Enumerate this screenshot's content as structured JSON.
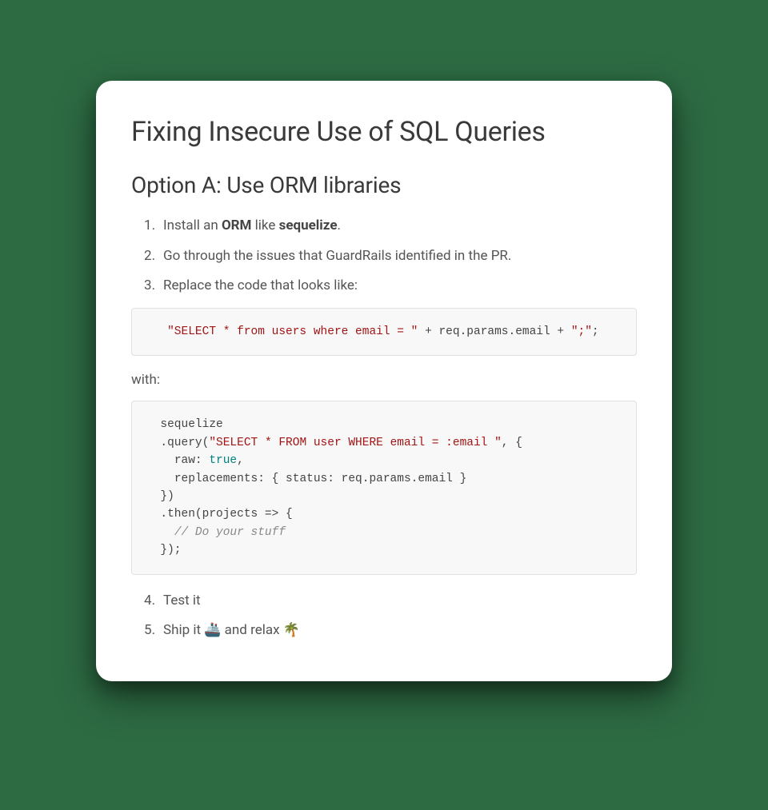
{
  "title": "Fixing Insecure Use of SQL Queries",
  "subtitle": "Option A: Use ORM libraries",
  "steps": {
    "s1_pre": "Install an ",
    "s1_orm": "ORM",
    "s1_mid": " like ",
    "s1_lib": "sequelize",
    "s1_post": ".",
    "s2": "Go through the issues that GuardRails identified in the PR.",
    "s3": "Replace the code that looks like:",
    "s4": "Test it",
    "s5_pre": "Ship it ",
    "s5_ship": "🚢",
    "s5_mid": " and relax ",
    "s5_palm": "🌴"
  },
  "with_label": "with:",
  "code1": {
    "indent": "   ",
    "str1": "\"SELECT * from users where email = \"",
    "mid": " + req.params.email + ",
    "str2": "\";\"",
    "tail": ";"
  },
  "code2": {
    "l1": "  sequelize",
    "l2a": "  .query(",
    "l2b": "\"SELECT * FROM user WHERE email = :email \"",
    "l2c": ", {",
    "l3a": "    raw: ",
    "l3b": "true",
    "l3c": ",",
    "l4": "    replacements: { status: req.params.email }",
    "l5": "  })",
    "l6": "  .then(projects => {",
    "l7": "    // Do your stuff",
    "l8": "  });"
  }
}
